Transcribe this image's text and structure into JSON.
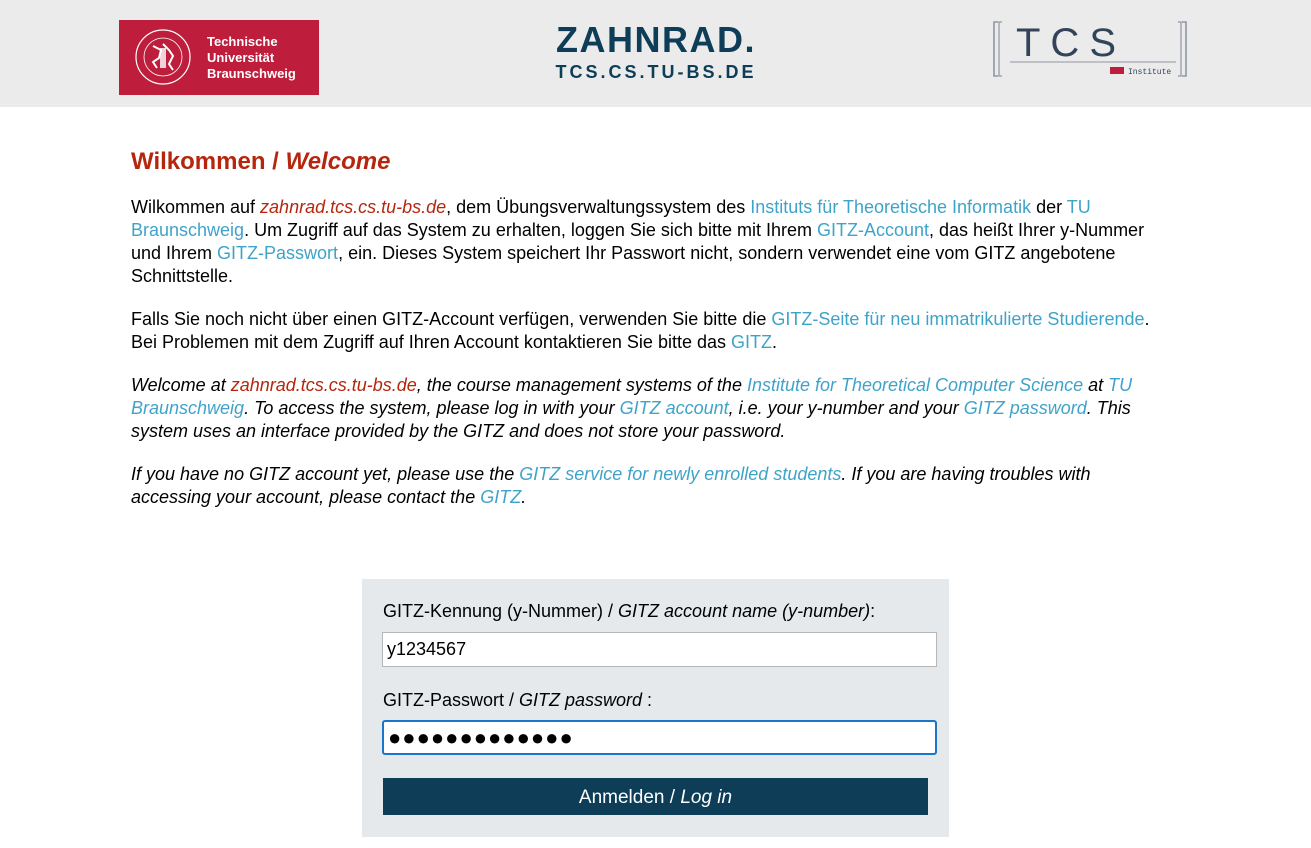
{
  "header": {
    "tu_logo_lines": [
      "Technische",
      "Universität",
      "Braunschweig"
    ],
    "tu_seal_text": "CAROLO-WILHELMINA BRAUNSCHWEIG",
    "title": "ZAHNRAD.",
    "subtitle": "TCS.CS.TU-BS.DE",
    "tcs_logo_text": "TCS",
    "tcs_logo_sub": "Institute",
    "tu_color": "#be1e3c",
    "accent_color": "#0d3d57"
  },
  "heading": {
    "de": "Wilkommen / ",
    "en": "Welcome"
  },
  "intro_de": {
    "t1": "Wilkommen auf ",
    "site": "zahnrad.tcs.cs.tu-bs.de",
    "t2": ", dem Übungsverwaltungssystem des ",
    "link_institute": "Instituts für Theoretische Informatik",
    "t3": " der ",
    "link_tu": "TU Braunschweig",
    "t4": ". Um Zugriff auf das System zu erhalten, loggen Sie sich bitte mit Ihrem ",
    "link_account": "GITZ-Account",
    "t5": ", das heißt Ihrer y-Nummer und Ihrem ",
    "link_password": "GITZ-Passwort",
    "t6": ", ein. Dieses System speichert Ihr Passwort nicht, sondern verwendet eine vom GITZ angebotene Schnittstelle."
  },
  "help_de": {
    "t1": "Falls Sie noch nicht über einen GITZ-Account verfügen, verwenden Sie bitte die ",
    "link_new": "GITZ-Seite für neu immatrikulierte Studierende",
    "t2": ". Bei Problemen mit dem Zugriff auf Ihren Account kontaktieren Sie bitte das ",
    "link_gitz": "GITZ",
    "t3": "."
  },
  "intro_en": {
    "t1": "Welcome at ",
    "site": "zahnrad.tcs.cs.tu-bs.de",
    "t2": ", the course management systems of the ",
    "link_institute": "Institute for Theoretical Computer Science",
    "t3": " at ",
    "link_tu": "TU Braunschweig",
    "t4": ". To access the system, please log in with your ",
    "link_account": "GITZ account",
    "t5": ", i.e. your y-number and your ",
    "link_password": "GITZ password",
    "t6": ". This system uses an interface provided by the GITZ and does not store your password."
  },
  "help_en": {
    "t1": "If you have no GITZ account yet, please use the ",
    "link_new": "GITZ service for newly enrolled students",
    "t2": ". If you are having troubles with accessing your account, please contact the ",
    "link_gitz": "GITZ",
    "t3": "."
  },
  "login": {
    "username_label_de": "GITZ-Kennung (y-Nummer) / ",
    "username_label_en": "GITZ account name (y-number)",
    "username_label_end": ":",
    "username_value": "y1234567",
    "password_label_de": "GITZ-Passwort / ",
    "password_label_en": "GITZ password",
    "password_label_end": " :",
    "password_value": "●●●●●●●●●●●●●",
    "button_de": "Anmelden / ",
    "button_en": "Log in"
  }
}
